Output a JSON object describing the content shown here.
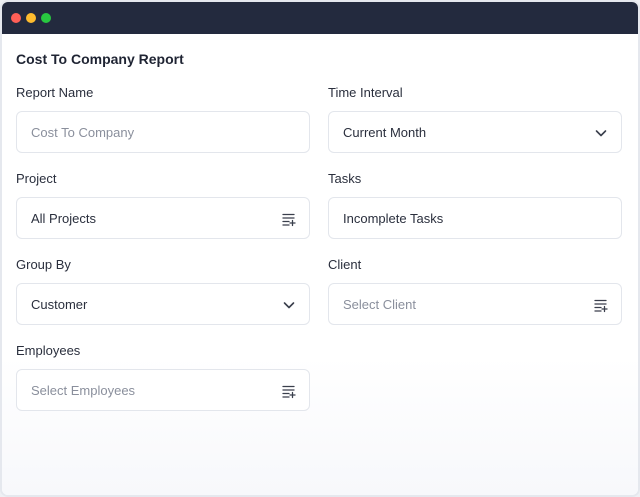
{
  "report": {
    "title": "Cost To Company Report"
  },
  "fields": {
    "report_name": {
      "label": "Report Name",
      "placeholder": "Cost To Company"
    },
    "time_interval": {
      "label": "Time Interval",
      "value": "Current Month"
    },
    "project": {
      "label": "Project",
      "value": "All Projects"
    },
    "tasks": {
      "label": "Tasks",
      "value": "Incomplete Tasks"
    },
    "group_by": {
      "label": "Group By",
      "value": "Customer"
    },
    "client": {
      "label": "Client",
      "placeholder": "Select Client"
    },
    "employees": {
      "label": "Employees",
      "placeholder": "Select Employees"
    }
  },
  "icons": {
    "chevron": "chevron-down-icon",
    "multi_select": "list-add-icon"
  },
  "colors": {
    "titlebar": "#232a3e",
    "window_close": "#ff5f57",
    "window_minimize": "#febc2e",
    "window_maximize": "#28c840"
  }
}
